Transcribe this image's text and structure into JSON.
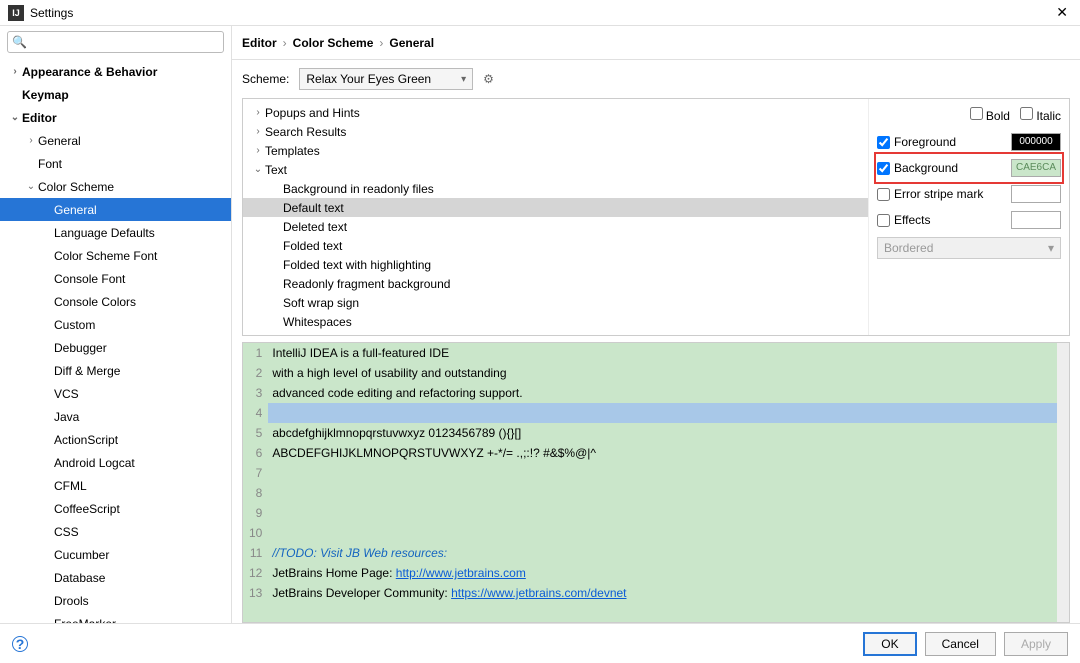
{
  "window": {
    "title": "Settings"
  },
  "search": {
    "placeholder": ""
  },
  "nav": [
    {
      "label": "Appearance & Behavior",
      "depth": 0,
      "arrow": "right",
      "bold": true
    },
    {
      "label": "Keymap",
      "depth": 0,
      "arrow": "none",
      "bold": true
    },
    {
      "label": "Editor",
      "depth": 0,
      "arrow": "down",
      "bold": true
    },
    {
      "label": "General",
      "depth": 1,
      "arrow": "right"
    },
    {
      "label": "Font",
      "depth": 1,
      "arrow": "none"
    },
    {
      "label": "Color Scheme",
      "depth": 1,
      "arrow": "down"
    },
    {
      "label": "General",
      "depth": 2,
      "arrow": "none",
      "selected": true
    },
    {
      "label": "Language Defaults",
      "depth": 2,
      "arrow": "none"
    },
    {
      "label": "Color Scheme Font",
      "depth": 2,
      "arrow": "none"
    },
    {
      "label": "Console Font",
      "depth": 2,
      "arrow": "none"
    },
    {
      "label": "Console Colors",
      "depth": 2,
      "arrow": "none"
    },
    {
      "label": "Custom",
      "depth": 2,
      "arrow": "none"
    },
    {
      "label": "Debugger",
      "depth": 2,
      "arrow": "none"
    },
    {
      "label": "Diff & Merge",
      "depth": 2,
      "arrow": "none"
    },
    {
      "label": "VCS",
      "depth": 2,
      "arrow": "none"
    },
    {
      "label": "Java",
      "depth": 2,
      "arrow": "none"
    },
    {
      "label": "ActionScript",
      "depth": 2,
      "arrow": "none"
    },
    {
      "label": "Android Logcat",
      "depth": 2,
      "arrow": "none"
    },
    {
      "label": "CFML",
      "depth": 2,
      "arrow": "none"
    },
    {
      "label": "CoffeeScript",
      "depth": 2,
      "arrow": "none"
    },
    {
      "label": "CSS",
      "depth": 2,
      "arrow": "none"
    },
    {
      "label": "Cucumber",
      "depth": 2,
      "arrow": "none"
    },
    {
      "label": "Database",
      "depth": 2,
      "arrow": "none"
    },
    {
      "label": "Drools",
      "depth": 2,
      "arrow": "none"
    },
    {
      "label": "FreeMarker",
      "depth": 2,
      "arrow": "none"
    }
  ],
  "breadcrumb": {
    "a": "Editor",
    "b": "Color Scheme",
    "c": "General"
  },
  "scheme": {
    "label": "Scheme:",
    "value": "Relax Your Eyes Green"
  },
  "tree": [
    {
      "label": "Popups and Hints",
      "depth": 0,
      "arrow": "right"
    },
    {
      "label": "Search Results",
      "depth": 0,
      "arrow": "right"
    },
    {
      "label": "Templates",
      "depth": 0,
      "arrow": "right"
    },
    {
      "label": "Text",
      "depth": 0,
      "arrow": "down"
    },
    {
      "label": "Background in readonly files",
      "depth": 1,
      "arrow": "none"
    },
    {
      "label": "Default text",
      "depth": 1,
      "arrow": "none",
      "selected": true
    },
    {
      "label": "Deleted text",
      "depth": 1,
      "arrow": "none"
    },
    {
      "label": "Folded text",
      "depth": 1,
      "arrow": "none"
    },
    {
      "label": "Folded text with highlighting",
      "depth": 1,
      "arrow": "none"
    },
    {
      "label": "Readonly fragment background",
      "depth": 1,
      "arrow": "none"
    },
    {
      "label": "Soft wrap sign",
      "depth": 1,
      "arrow": "none"
    },
    {
      "label": "Whitespaces",
      "depth": 1,
      "arrow": "none"
    }
  ],
  "attrs": {
    "bold": "Bold",
    "italic": "Italic",
    "foreground": {
      "label": "Foreground",
      "value": "000000",
      "bg": "#000000",
      "fg": "#ffffff",
      "checked": true
    },
    "background": {
      "label": "Background",
      "value": "CAE6CA",
      "bg": "#CAE6CA",
      "fg": "#5a8a5a",
      "checked": true
    },
    "error": {
      "label": "Error stripe mark",
      "checked": false
    },
    "effects": {
      "label": "Effects",
      "checked": false,
      "option": "Bordered"
    }
  },
  "preview": {
    "lines": [
      "IntelliJ IDEA is a full-featured IDE",
      "with a high level of usability and outstanding",
      "advanced code editing and refactoring support.",
      "",
      "abcdefghijklmnopqrstuvwxyz 0123456789 (){}[]",
      "ABCDEFGHIJKLMNOPQRSTUVWXYZ +-*/= .,;:!? #&$%@|^",
      "",
      "",
      "",
      "",
      "//TODO: Visit JB Web resources:",
      "JetBrains Home Page: http://www.jetbrains.com",
      "JetBrains Developer Community: https://www.jetbrains.com/devnet"
    ],
    "link1_prefix": "JetBrains Home Page: ",
    "link1_url": "http://www.jetbrains.com",
    "link2_prefix": "JetBrains Developer Community: ",
    "link2_url": "https://www.jetbrains.com/devnet",
    "todo_text": "//TODO: Visit JB Web resources:"
  },
  "footer": {
    "ok": "OK",
    "cancel": "Cancel",
    "apply": "Apply"
  }
}
